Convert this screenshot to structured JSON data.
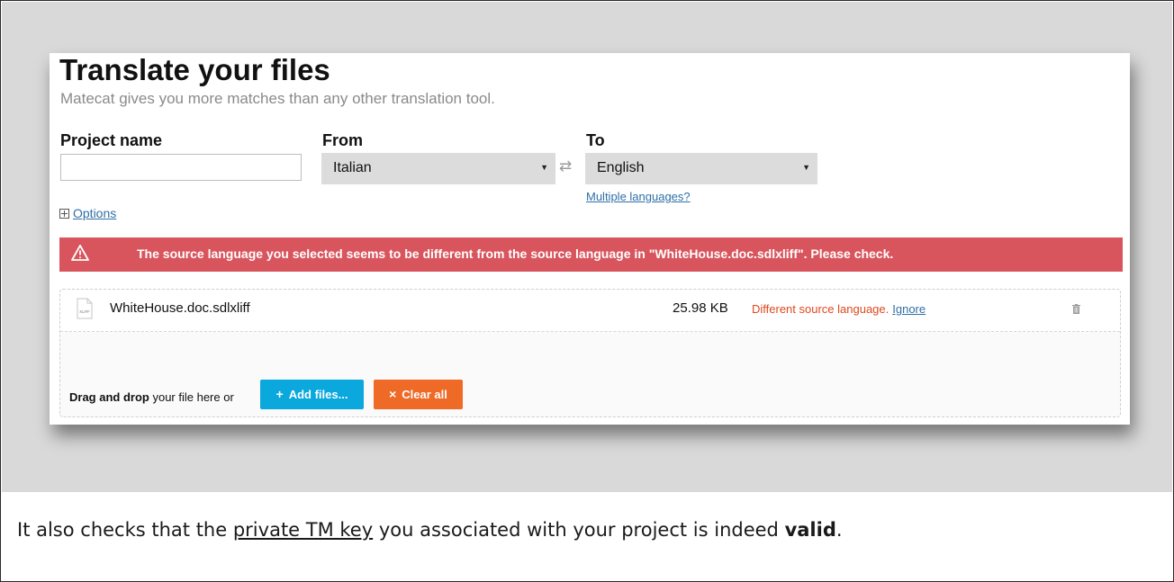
{
  "header": {
    "title": "Translate your files",
    "subtitle": "Matecat gives you more matches than any other translation tool."
  },
  "form": {
    "project_label": "Project name",
    "project_value": "",
    "from_label": "From",
    "from_value": "Italian",
    "to_label": "To",
    "to_value": "English",
    "multiple_languages": "Multiple languages?",
    "options_label": "Options"
  },
  "warning": {
    "text": "The source language you selected seems to be different from the source language in \"WhiteHouse.doc.sdlxliff\". Please check.",
    "color": "#d9555d"
  },
  "files": [
    {
      "icon_label": "XLIFF",
      "name": "WhiteHouse.doc.sdlxliff",
      "size": "25.98 KB",
      "error": "Different source language.",
      "ignore": "Ignore"
    }
  ],
  "upload": {
    "drag_bold": "Drag and drop",
    "drag_rest": "your file here or",
    "add_label": "Add files...",
    "clear_label": "Clear all",
    "add_color": "#0aa8dd",
    "clear_color": "#ef6a26"
  },
  "caption": {
    "part1": "It also checks that the ",
    "link": "private TM key",
    "part2": " you associated with your project is indeed ",
    "bold": "valid",
    "part3": "."
  }
}
